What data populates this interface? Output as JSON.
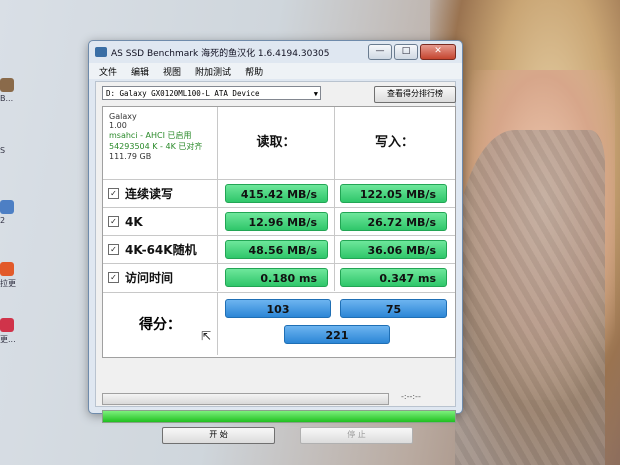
{
  "window": {
    "title": "AS SSD Benchmark 海死的鱼汉化 1.6.4194.30305",
    "minimize": "—",
    "maximize": "□",
    "close": "✕"
  },
  "menu": [
    "文件",
    "编辑",
    "视图",
    "附加测试",
    "帮助"
  ],
  "device": {
    "selected": "D: Galaxy GX0120ML100-L ATA Device",
    "rank_button": "查看得分排行榜"
  },
  "info": {
    "name": "Galaxy",
    "firmware": "1.00",
    "driver": "msahci - AHCI 已启用",
    "alignment": "54293504 K - 4K 已对齐",
    "size": "111.79 GB"
  },
  "headers": {
    "read": "读取：",
    "write": "写入："
  },
  "rows": [
    {
      "label": "连续读写",
      "checked": "✓",
      "read": "415.42 MB/s",
      "write": "122.05 MB/s"
    },
    {
      "label": "4K",
      "checked": "✓",
      "read": "12.96 MB/s",
      "write": "26.72 MB/s"
    },
    {
      "label": "4K-64K随机",
      "checked": "✓",
      "read": "48.56 MB/s",
      "write": "36.06 MB/s"
    },
    {
      "label": "访问时间",
      "checked": "✓",
      "read": "0.180 ms",
      "write": "0.347 ms"
    }
  ],
  "score": {
    "label": "得分：",
    "read": "103",
    "write": "75",
    "total": "221"
  },
  "timer": "-:--:--",
  "progress_fraction": 1.0,
  "buttons": {
    "start": "开 始",
    "stop": "停 止"
  },
  "desktop_icons": [
    "B...",
    "S",
    "2",
    "拉更",
    "更..."
  ],
  "colors": {
    "result_green": "#2fc66a",
    "score_blue": "#2c86d6"
  }
}
